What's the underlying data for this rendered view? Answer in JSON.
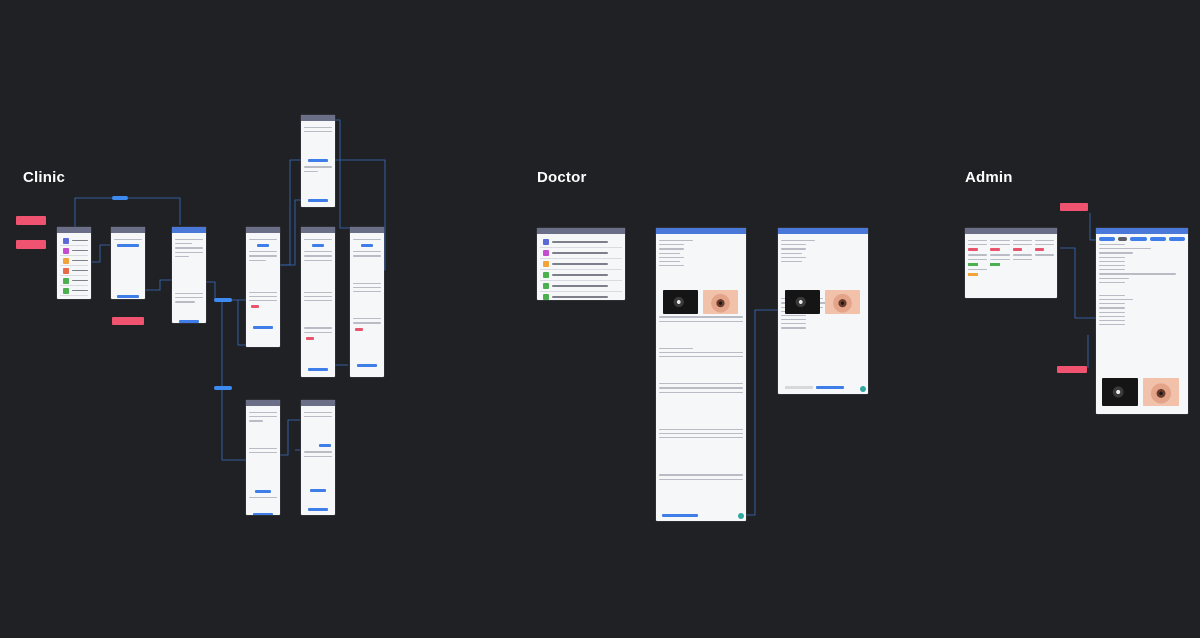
{
  "sections": {
    "clinic": "Clinic",
    "doctor": "Doctor",
    "admin": "Admin"
  },
  "colors": {
    "canvas": "#202124",
    "frame_header": "#6a6e86",
    "accent_blue": "#3f7de8",
    "note_pink": "#f0536f",
    "wire": "#3a6fc2"
  },
  "icons": {
    "clinic_row_icons": [
      "#5a6bd8",
      "#c64ccf",
      "#f2a33a",
      "#e86a4a",
      "#4cb04f",
      "#4cb04f"
    ],
    "doctor_row_icons": [
      "#5a6bd8",
      "#c64ccf",
      "#f2a33a",
      "#4cb04f",
      "#4cb04f",
      "#4cb04f"
    ]
  }
}
